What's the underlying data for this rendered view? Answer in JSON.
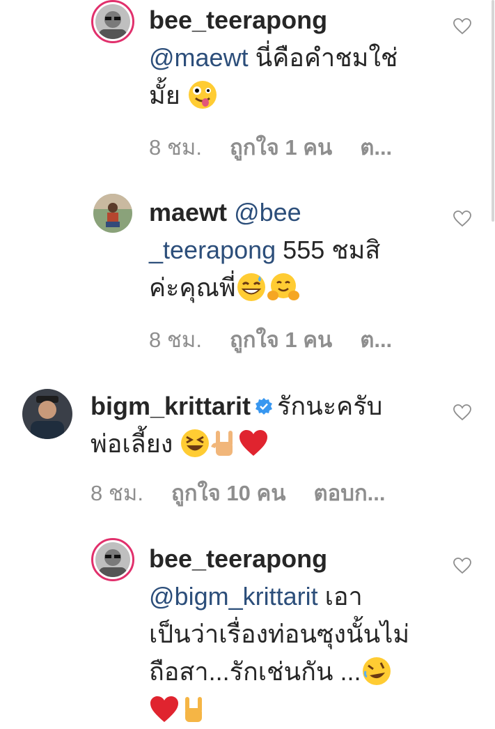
{
  "comments": [
    {
      "username": "bee_teerapong",
      "mention": "@maewt",
      "text_line1": " นี่คือคำชมใช่",
      "text_line2": "มั้ย",
      "time": "8 ชม.",
      "likes": "ถูกใจ 1 คน",
      "reply": "ต..."
    },
    {
      "username": "maewt",
      "mention_line1": "@bee",
      "mention_line2": "_teerapong",
      "text_line2": " 555 ชมสิ",
      "text_line3": "ค่ะคุณพี่",
      "time": "8 ชม.",
      "likes": "ถูกใจ 1 คน",
      "reply": "ต..."
    },
    {
      "username": "bigm_krittarit",
      "text_line1": "รักนะครับ",
      "text_line2": "พ่อเลี้ยง",
      "time": "8 ชม.",
      "likes": "ถูกใจ 10 คน",
      "reply": "ตอบก..."
    },
    {
      "username": "bee_teerapong",
      "mention": "@bigm_krittarit",
      "text_line2_tail": " เอา",
      "text_line3": "เป็นว่าเรื่องท่อนซุงนั้นไม่",
      "text_line4": "ถือสา...รักเช่นกัน ..."
    }
  ],
  "colors": {
    "text": "#262626",
    "meta": "#8e8e8e",
    "mention": "#2c4e7a",
    "verified": "#3897f0",
    "story_ring": "#e1306c"
  }
}
